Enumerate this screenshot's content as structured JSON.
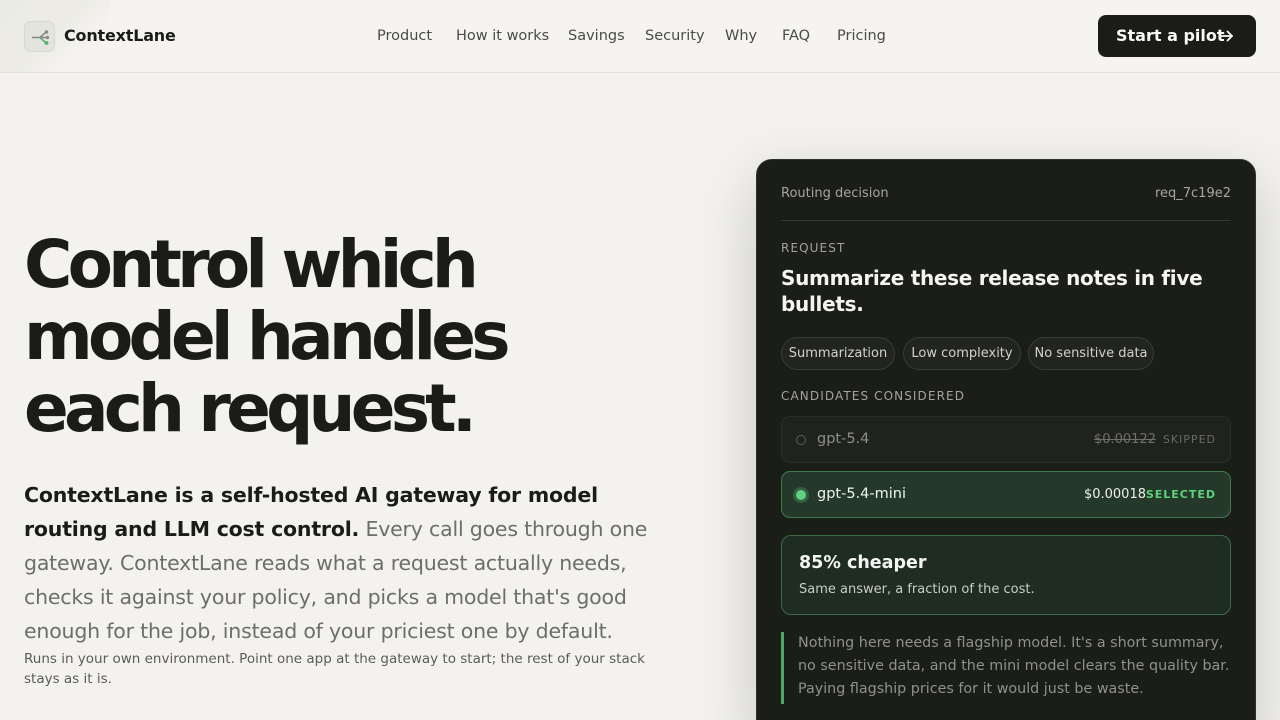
{
  "header": {
    "brand": "ContextLane",
    "nav": [
      "Product",
      "How it works",
      "Savings",
      "Security",
      "Why",
      "FAQ",
      "Pricing"
    ],
    "cta_label": "Start a pilot",
    "cta_icon": "arrow-right-icon",
    "logo_icon": "routing-branch-icon"
  },
  "hero": {
    "title_lines": [
      "Control which",
      "model handles",
      "each request."
    ],
    "lead_bold": "ContextLane is a self-hosted AI gateway for model routing and LLM cost control.",
    "lead_rest": " Every call goes through one gateway. ContextLane reads what a request actually needs, checks it against your policy, and picks a model that's good enough for the job, instead of your priciest one by default.",
    "note": "Runs in your own environment. Point one app at the gateway to start; the rest of your stack stays as it is."
  },
  "card": {
    "heading": "Routing decision",
    "request_id": "req_7c19e2",
    "request_label": "REQUEST",
    "request_text": "Summarize these release notes in five bullets.",
    "tags": [
      "Summarization",
      "Low complexity",
      "No sensitive data"
    ],
    "candidates_label": "CANDIDATES CONSIDERED",
    "candidates": [
      {
        "name": "gpt-5.4",
        "price": "$0.00122",
        "status": "SKIPPED"
      },
      {
        "name": "gpt-5.4-mini",
        "price": "$0.00018",
        "status": "SELECTED"
      }
    ],
    "savings_title": "85% cheaper",
    "savings_sub": "Same answer, a fraction of the cost.",
    "reason": "Nothing here needs a flagship model. It's a short summary, no sensitive data, and the mini model clears the quality bar. Paying flagship prices for it would just be waste."
  },
  "colors": {
    "accent": "#5fd07f",
    "card_bg": "#1b1d19",
    "page_bg": "#f3f2ee",
    "cta_bg": "#1b1c19"
  }
}
